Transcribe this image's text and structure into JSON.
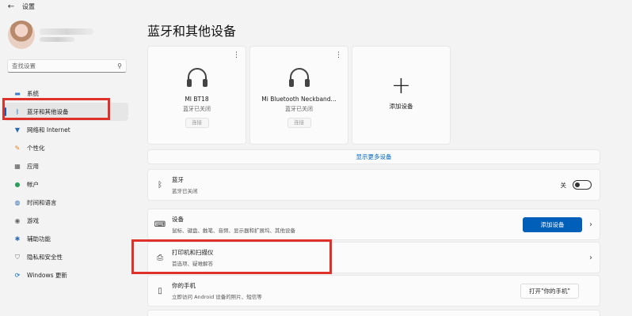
{
  "window": {
    "back_icon": "back-arrow-icon",
    "title": "设置"
  },
  "search": {
    "placeholder": "查找设置",
    "icon": "search-icon"
  },
  "sidebar": {
    "items": [
      {
        "label": "系统",
        "icon": "monitor-icon",
        "active": false
      },
      {
        "label": "蓝牙和其他设备",
        "icon": "bluetooth-icon",
        "active": true
      },
      {
        "label": "网络和 Internet",
        "icon": "wifi-icon",
        "active": false
      },
      {
        "label": "个性化",
        "icon": "brush-icon",
        "active": false
      },
      {
        "label": "应用",
        "icon": "apps-icon",
        "active": false
      },
      {
        "label": "帐户",
        "icon": "person-icon",
        "active": false
      },
      {
        "label": "时间和语言",
        "icon": "globe-clock-icon",
        "active": false
      },
      {
        "label": "游戏",
        "icon": "gamepad-icon",
        "active": false
      },
      {
        "label": "辅助功能",
        "icon": "accessibility-icon",
        "active": false
      },
      {
        "label": "隐私和安全性",
        "icon": "shield-icon",
        "active": false
      },
      {
        "label": "Windows 更新",
        "icon": "update-icon",
        "active": false
      }
    ]
  },
  "main": {
    "title": "蓝牙和其他设备",
    "devices": [
      {
        "name": "MI BT18",
        "status": "蓝牙已关闭",
        "button": "连接",
        "icon": "headphones-icon"
      },
      {
        "name": "Mi Bluetooth Neckband...",
        "status": "蓝牙已关闭",
        "button": "连接",
        "icon": "headphones-icon"
      }
    ],
    "add_device_tile": {
      "label": "添加设备",
      "icon": "plus-icon"
    },
    "show_more": "显示更多设备",
    "bluetooth_row": {
      "title": "蓝牙",
      "subtitle": "蓝牙已关闭",
      "toggle_label": "关",
      "toggle_on": false,
      "icon": "bluetooth-icon"
    },
    "devices_row": {
      "title": "设备",
      "subtitle": "鼠标、键盘、触笔、音频、显示器和扩展坞、其他设备",
      "button": "添加设备",
      "icon": "devices-icon"
    },
    "printers_row": {
      "title": "打印机和扫描仪",
      "subtitle": "首选项、疑难解答",
      "icon": "printer-icon"
    },
    "phone_row": {
      "title": "你的手机",
      "subtitle": "立即访问 Android 设备的照片、短信等",
      "button": "打开\"你的手机\"",
      "icon": "phone-icon"
    }
  },
  "colors": {
    "accent": "#0067c0",
    "highlight_box": "#e0302a",
    "background": "#f3f3f3"
  }
}
